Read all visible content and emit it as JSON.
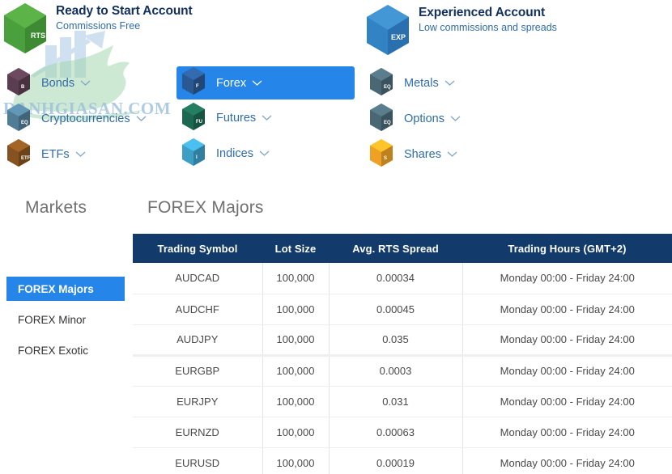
{
  "watermark": {
    "text": "DANHGIASAN.COM"
  },
  "accounts": [
    {
      "badge": "RTS",
      "title": "Ready to Start Account",
      "subtitle": "Commissions Free",
      "color": "#4a9f3e"
    },
    {
      "badge": "EXP",
      "title": "Experienced Account",
      "subtitle": "Low commissions and spreads",
      "color": "#2f80c2"
    }
  ],
  "instrument_menu": {
    "column1": [
      {
        "badge": "B",
        "label": "Bonds",
        "color": "#5d3f52",
        "active": false
      },
      {
        "badge": "EQ",
        "label": "Cryptocurrencies",
        "color": "#53809b",
        "active": false
      },
      {
        "badge": "ETF",
        "label": "ETFs",
        "color": "#8a5520",
        "active": false
      }
    ],
    "column2": [
      {
        "badge": "F",
        "label": "Forex",
        "color": "#2b5b96",
        "active": true
      },
      {
        "badge": "FU",
        "label": "Futures",
        "color": "#1e6b53",
        "active": false
      },
      {
        "badge": "I",
        "label": "Indices",
        "color": "#3fa3cc",
        "active": false
      }
    ],
    "column3": [
      {
        "badge": "EQ",
        "label": "Metals",
        "color": "#4c6b78",
        "active": false
      },
      {
        "badge": "EQ",
        "label": "Options",
        "color": "#4c6b78",
        "active": false
      },
      {
        "badge": "S",
        "label": "Shares",
        "color": "#f5a623",
        "active": false
      }
    ]
  },
  "sidebar": {
    "heading": "Markets",
    "items": [
      {
        "label": "FOREX Majors",
        "active": true
      },
      {
        "label": "FOREX Minor",
        "active": false
      },
      {
        "label": "FOREX Exotic",
        "active": false
      }
    ]
  },
  "table": {
    "title": "FOREX Majors",
    "columns": [
      "Trading Symbol",
      "Lot Size",
      "Avg. RTS Spread",
      "Trading Hours (GMT+2)"
    ],
    "rows": [
      {
        "symbol": "AUDCAD",
        "lot": "100,000",
        "spread": "0.00034",
        "hours": "Monday 00:00 - Friday 24:00",
        "sep": false
      },
      {
        "symbol": "AUDCHF",
        "lot": "100,000",
        "spread": "0.00045",
        "hours": "Monday 00:00 - Friday 24:00",
        "sep": false
      },
      {
        "symbol": "AUDJPY",
        "lot": "100,000",
        "spread": "0.035",
        "hours": "Monday 00:00 - Friday 24:00",
        "sep": false
      },
      {
        "symbol": "EURGBP",
        "lot": "100,000",
        "spread": "0.0003",
        "hours": "Monday 00:00 - Friday 24:00",
        "sep": true
      },
      {
        "symbol": "EURJPY",
        "lot": "100,000",
        "spread": "0.031",
        "hours": "Monday 00:00 - Friday 24:00",
        "sep": false
      },
      {
        "symbol": "EURNZD",
        "lot": "100,000",
        "spread": "0.00063",
        "hours": "Monday 00:00 - Friday 24:00",
        "sep": false
      },
      {
        "symbol": "EURUSD",
        "lot": "100,000",
        "spread": "0.00019",
        "hours": "Monday 00:00 - Friday 24:00",
        "sep": false
      }
    ]
  },
  "colors": {
    "accent_blue": "#2585e8",
    "header_navy": "#123a6b",
    "title_navy": "#12305e",
    "link_blue": "#2f6ca8",
    "heading_gray": "#707070"
  }
}
